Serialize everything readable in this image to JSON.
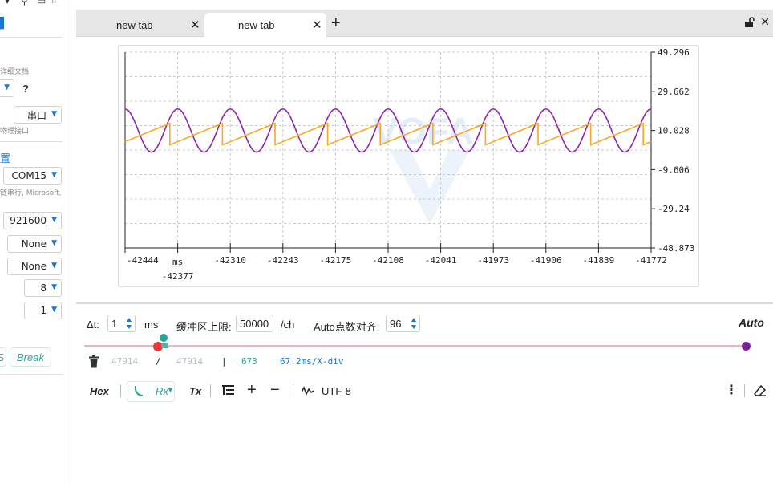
{
  "tabs": [
    {
      "label": "new tab",
      "active": false
    },
    {
      "label": "new tab",
      "active": true
    }
  ],
  "sidebar": {
    "hint_doc": "详细文档",
    "protocol_value": "",
    "help": "?",
    "port_type_value": "串口",
    "hint_physical": "物理接口",
    "section_mark": "置",
    "port_value": "COM15",
    "port_desc": "链串行, Microsoft,",
    "baud_value": "921600",
    "parity_value": "None",
    "flow_value": "None",
    "databits_value": "8",
    "stopbits_value": "1",
    "break_label": "Break",
    "partial_btn_label": "S"
  },
  "chart_data": {
    "type": "line",
    "title": "",
    "xlabel": "ms",
    "ylabel": "",
    "x_ticks": [
      "-42444",
      "-42377",
      "-42310",
      "-42243",
      "-42175",
      "-42108",
      "-42041",
      "-41973",
      "-41906",
      "-41839",
      "-41772"
    ],
    "y_ticks": [
      "49.296",
      "29.662",
      "10.028",
      "-9.606",
      "-29.24",
      "-48.873"
    ],
    "x_unit": "ms",
    "ylim": [
      -48.873,
      49.296
    ],
    "xlim": [
      -42444,
      -41772
    ],
    "grid": true,
    "series": [
      {
        "color": "#8e24aa",
        "kind": "sine",
        "center": 10.0,
        "amplitude": 10.8,
        "cycles": 10,
        "start_phase_deg": 90
      },
      {
        "color": "#f9a825",
        "kind": "sawtooth",
        "min": 2.8,
        "max": 13.6,
        "cycles": 10
      }
    ],
    "watermark": "VOFA"
  },
  "controls": {
    "dt_label": "Δt:",
    "dt_value": "1",
    "dt_unit": "ms",
    "buffer_label": "缓冲区上限:",
    "buffer_value": "50000",
    "buffer_unit": "/ch",
    "auto_align_label": "Auto点数对齐:",
    "auto_align_value": "96",
    "auto_label": "Auto",
    "slider_start": 0.11,
    "slider_end": 1.0
  },
  "stats": {
    "count_a": "47914",
    "sep": "/",
    "count_b": "47914",
    "bar": "|",
    "points": "673",
    "per_div": "67.2ms/X-div"
  },
  "toolbar": {
    "hex_label": "Hex",
    "rx_label": "Rx",
    "tx_label": "Tx",
    "encoding": "UTF-8"
  },
  "colors": {
    "accent_teal": "#26a69a",
    "accent_blue": "#1976d2",
    "sine": "#8e24aa",
    "saw": "#f9a825",
    "slider_red": "#e53935",
    "slider_purple": "#7b1fa2"
  }
}
